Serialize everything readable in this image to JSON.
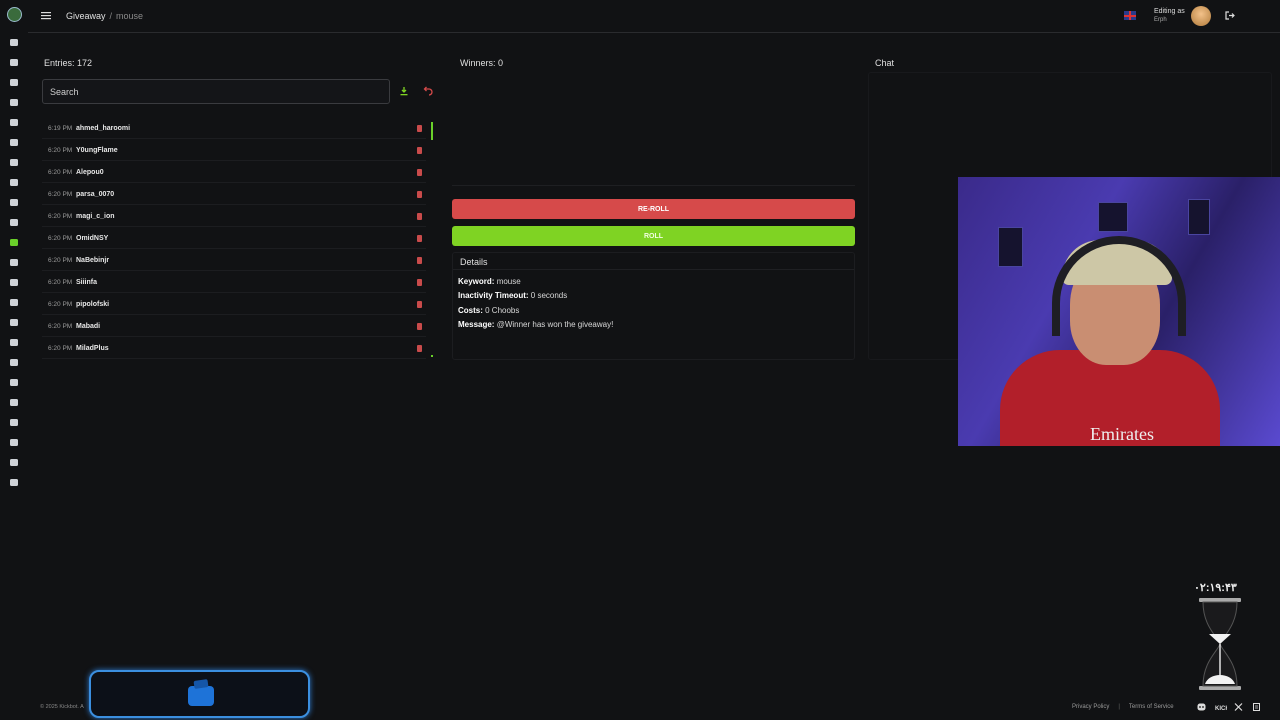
{
  "sidebar": {
    "icons": [
      "dashboard-icon",
      "document-icon",
      "pen-icon",
      "wrench-icon",
      "chat-icon",
      "clock-icon",
      "shield-icon",
      "alert-icon",
      "music-icon",
      "star-icon",
      "gift-icon",
      "cart-icon",
      "link-icon",
      "chart-icon",
      "video-icon",
      "box-icon",
      "smile-icon",
      "film-icon",
      "message-icon",
      "monitor-icon",
      "search-icon",
      "gamepad-icon",
      "card-icon"
    ],
    "active": "gift-icon"
  },
  "header": {
    "breadcrumb_parent": "Giveaway",
    "breadcrumb_sep": "/",
    "breadcrumb_current": "mouse",
    "editing_label": "Editing as",
    "editing_user": "Erph"
  },
  "entries": {
    "title": "Entries: 172",
    "search_placeholder": "Search",
    "items": [
      {
        "time": "6:19 PM",
        "name": "ahmed_haroomi"
      },
      {
        "time": "6:20 PM",
        "name": "Y0ungFlame"
      },
      {
        "time": "6:20 PM",
        "name": "Alepou0"
      },
      {
        "time": "6:20 PM",
        "name": "parsa_0070"
      },
      {
        "time": "6:20 PM",
        "name": "magi_c_ion"
      },
      {
        "time": "6:20 PM",
        "name": "OmidNSY"
      },
      {
        "time": "6:20 PM",
        "name": "NaBebinjr"
      },
      {
        "time": "6:20 PM",
        "name": "Siiinfa"
      },
      {
        "time": "6:20 PM",
        "name": "pipolofski"
      },
      {
        "time": "6:20 PM",
        "name": "Mabadi"
      },
      {
        "time": "6:20 PM",
        "name": "MiladPlus"
      }
    ]
  },
  "winners": {
    "title": "Winners: 0",
    "reroll_label": "RE-ROLL",
    "roll_label": "ROLL"
  },
  "details": {
    "title": "Details",
    "keyword_label": "Keyword:",
    "keyword_value": "mouse",
    "timeout_label": "Inactivity Timeout:",
    "timeout_value": "0 seconds",
    "costs_label": "Costs:",
    "costs_value": "0 Choobs",
    "message_label": "Message:",
    "message_value": "@Winner has won the giveaway!"
  },
  "chat": {
    "title": "Chat"
  },
  "webcam": {
    "shirt_text": "Emirates"
  },
  "timer": {
    "value": "۰۲:۱۹:۴۳"
  },
  "footer": {
    "copyright": "© 2025 Kickbot. A",
    "privacy": "Privacy Policy",
    "separator": "|",
    "terms": "Terms of Service",
    "social_icons": [
      "discord-icon",
      "kick-icon",
      "x-icon",
      "doc-icon"
    ]
  },
  "colors": {
    "background": "#111214",
    "reroll": "#d64a4a",
    "roll": "#7fd323",
    "accent_green": "#6ad02a",
    "wallet_border": "#3b8fe0"
  }
}
